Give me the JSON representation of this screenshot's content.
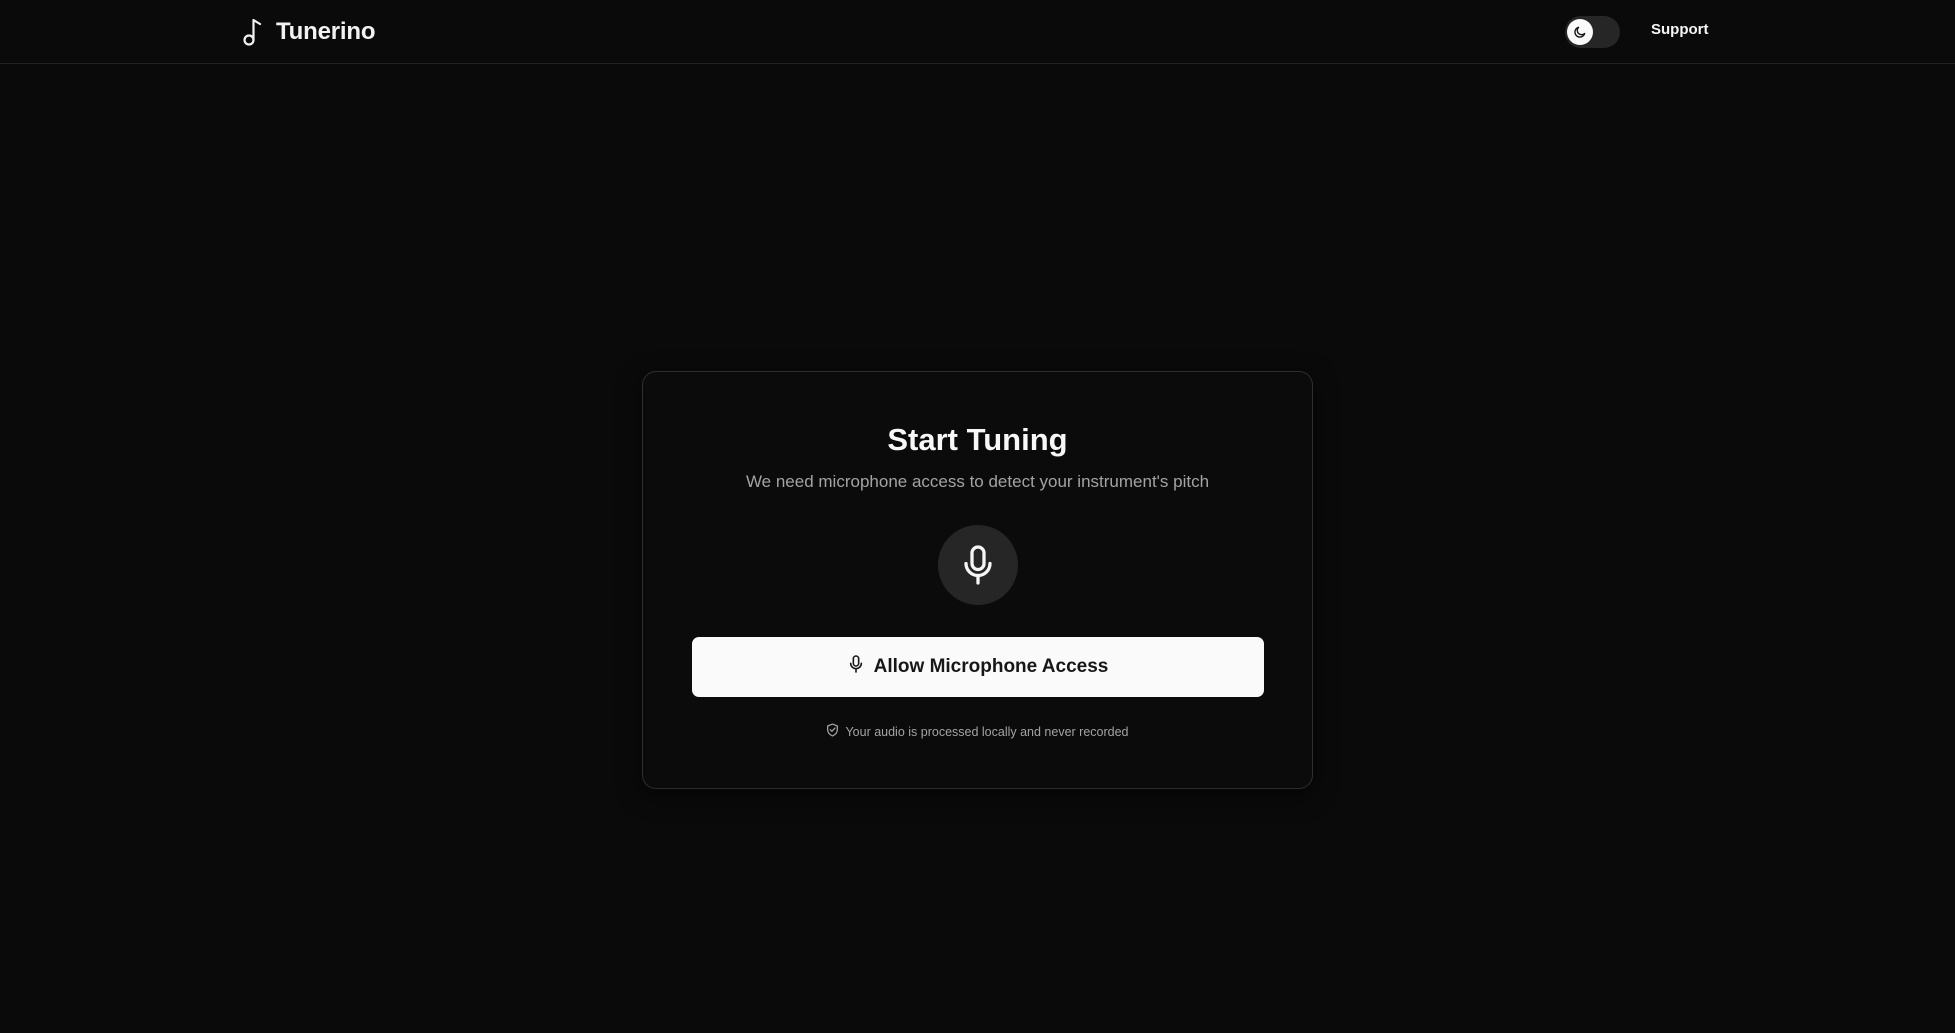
{
  "header": {
    "brand_name": "Tunerino",
    "brand_icon": "music-note-icon",
    "theme_toggle_icon": "moon-icon",
    "support_label": "Support"
  },
  "card": {
    "title": "Start Tuning",
    "subtitle": "We need microphone access to detect your instrument's pitch",
    "mic_icon": "microphone-icon",
    "button_label": "Allow Microphone Access",
    "button_icon": "microphone-icon",
    "privacy_icon": "shield-check-icon",
    "privacy_text": "Your audio is processed locally and never recorded"
  },
  "colors": {
    "background": "#0a0a0a",
    "card_border": "#2e2e2e",
    "button_bg": "#fafafa",
    "button_text": "#171717",
    "muted_text": "#a3a3a3",
    "toggle_track": "#262626"
  }
}
